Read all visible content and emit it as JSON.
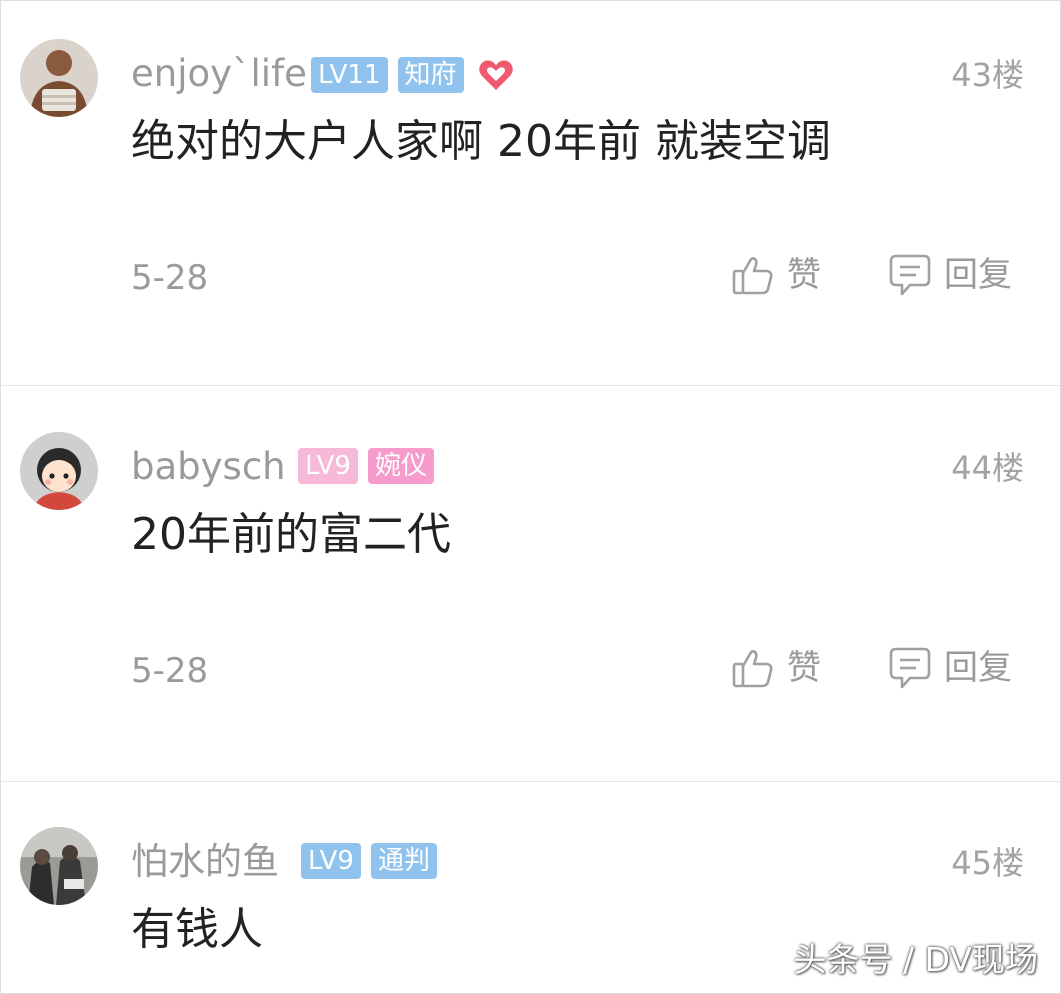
{
  "comments": [
    {
      "username": "enjoy`life",
      "level": "LV11",
      "title": "知府",
      "level_color": "#8fc3ee",
      "title_color": "#8fc3ee",
      "has_heart_badge": true,
      "floor": "43楼",
      "content": "绝对的大户人家啊 20年前 就装空调",
      "date": "5-28",
      "like_label": "赞",
      "reply_label": "回复"
    },
    {
      "username": "babysch",
      "level": "LV9",
      "title": "婉仪",
      "level_color": "#f7b9d8",
      "title_color": "#f59ccc",
      "has_heart_badge": false,
      "floor": "44楼",
      "content": "20年前的富二代",
      "date": "5-28",
      "like_label": "赞",
      "reply_label": "回复"
    },
    {
      "username": "怕水的鱼",
      "level": "LV9",
      "title": "通判",
      "level_color": "#8fc3ee",
      "title_color": "#8fc3ee",
      "has_heart_badge": false,
      "floor": "45楼",
      "content": "有钱人"
    }
  ],
  "watermark": "头条号 / DV现场",
  "icons": {
    "like": "thumbs-up-icon",
    "reply": "comment-bubble-icon",
    "heart": "heart-badge-icon"
  }
}
